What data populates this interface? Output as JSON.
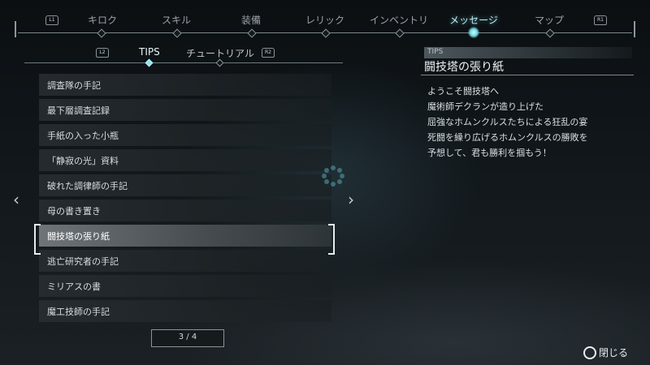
{
  "top_tabs": {
    "left_shoulder": "L1",
    "right_shoulder": "R1",
    "items": [
      "キロク",
      "スキル",
      "装備",
      "レリック",
      "インベントリ",
      "メッセージ",
      "マップ"
    ],
    "active": "メッセージ"
  },
  "sub_tabs": {
    "left_shoulder": "L2",
    "right_shoulder": "R2",
    "items": [
      "TIPS",
      "チュートリアル"
    ],
    "active": "TIPS"
  },
  "list": {
    "items": [
      "調査隊の手記",
      "最下層調査記録",
      "手紙の入った小瓶",
      "「静寂の光」資料",
      "破れた調律師の手記",
      "母の書き置き",
      "闘技塔の張り紙",
      "逃亡研究者の手記",
      "ミリアスの書",
      "魔工技師の手記"
    ],
    "selected_index": 6
  },
  "pager": {
    "text": "3 / 4"
  },
  "detail": {
    "category": "TIPS",
    "title": "闘技塔の張り紙",
    "lines": [
      "ようこそ闘技塔へ",
      "魔術師デクランが造り上げた",
      "屈強なホムンクルスたちによる狂乱の宴",
      "死闘を繰り広げるホムンクルスの勝敗を",
      "予想して、君も勝利を掴もう！"
    ]
  },
  "footer": {
    "close_label": "閉じる"
  },
  "colors": {
    "accent": "#6fd7e4",
    "text": "#dfe3e6"
  }
}
